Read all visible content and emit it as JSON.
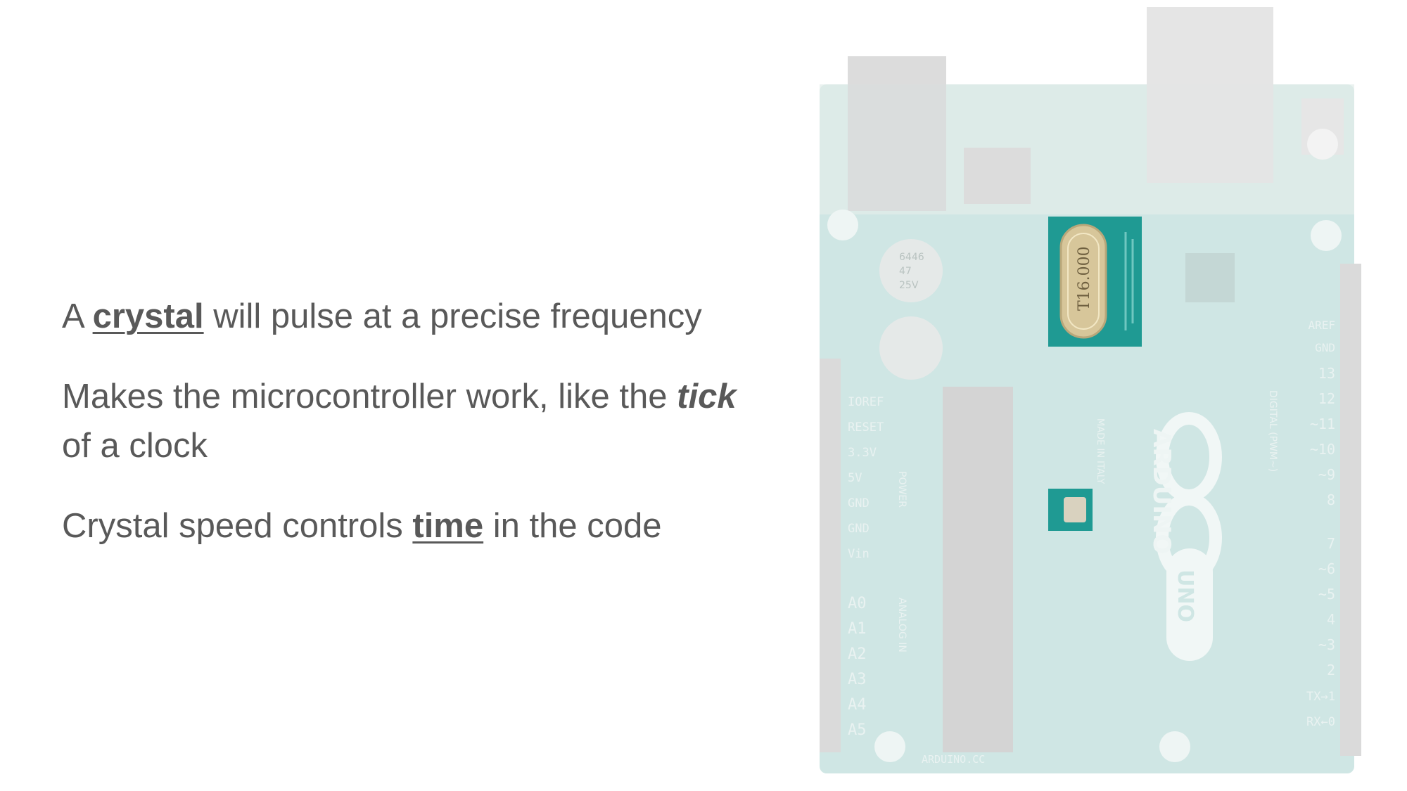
{
  "slide": {
    "paragraphs": [
      {
        "pre": "A ",
        "emph": "crystal",
        "post": " will pulse at a precise frequency"
      },
      {
        "pre": "Makes the microcontroller work, like the ",
        "emph": "tick",
        "post": " of a clock"
      },
      {
        "pre": "Crystal speed controls ",
        "emph": "time",
        "post": " in the code"
      }
    ]
  },
  "board": {
    "crystal_marking": "T16.000",
    "brand": "ARDUINO",
    "model": "UNO",
    "website": "ARDUINO.CC",
    "made_in": "MADE IN ITALY",
    "section_power": "POWER",
    "section_analog": "ANALOG IN",
    "section_digital": "DIGITAL (PWM~)",
    "cap_label_1": "6446",
    "cap_label_2": "47",
    "cap_label_3": "25V",
    "header_left_labels": [
      "IOREF",
      "RESET",
      "3.3V",
      "5V",
      "GND",
      "GND",
      "Vin"
    ],
    "analog_labels": [
      "A0",
      "A1",
      "A2",
      "A3",
      "A4",
      "A5"
    ],
    "digital_labels": [
      "AREF",
      "GND",
      "13",
      "12",
      "~11",
      "~10",
      "~9",
      "8",
      "7",
      "~6",
      "~5",
      "4",
      "~3",
      "2",
      "TX→1",
      "RX←0"
    ],
    "colors": {
      "board": "#cfe6e4",
      "board_highlight": "#1f9a93",
      "crystal": "#d7c69a"
    }
  }
}
